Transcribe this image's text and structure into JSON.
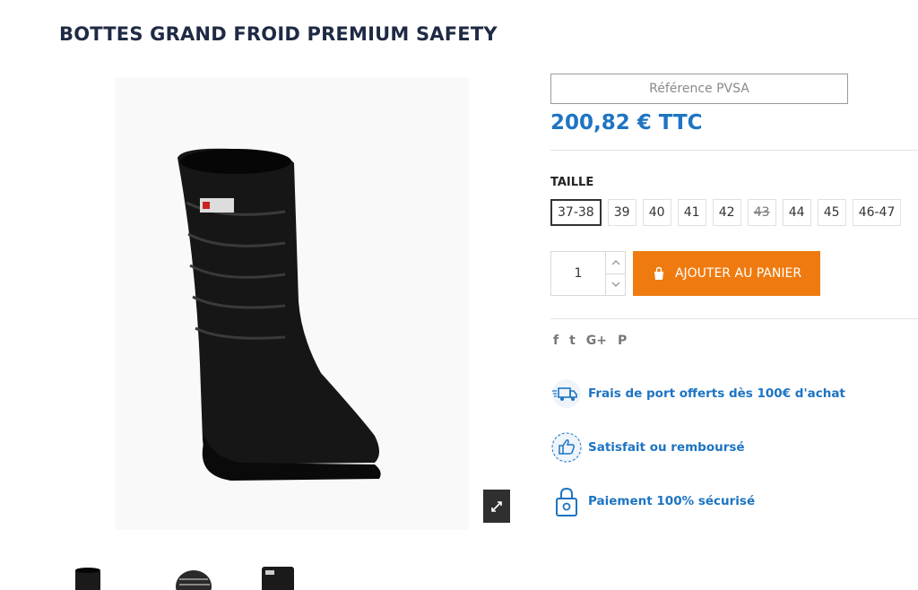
{
  "product": {
    "title": "BOTTES GRAND FROID PREMIUM SAFETY",
    "reference": "Référence PVSA",
    "price": "200,82 € TTC"
  },
  "size_selector": {
    "label": "TAILLE",
    "options": [
      {
        "label": "37-38",
        "selected": true,
        "available": true
      },
      {
        "label": "39",
        "selected": false,
        "available": true
      },
      {
        "label": "40",
        "selected": false,
        "available": true
      },
      {
        "label": "41",
        "selected": false,
        "available": true
      },
      {
        "label": "42",
        "selected": false,
        "available": true
      },
      {
        "label": "43",
        "selected": false,
        "available": false
      },
      {
        "label": "44",
        "selected": false,
        "available": true
      },
      {
        "label": "45",
        "selected": false,
        "available": true
      },
      {
        "label": "46-47",
        "selected": false,
        "available": true
      }
    ]
  },
  "cart": {
    "quantity": "1",
    "add_label": "AJOUTER AU PANIER"
  },
  "social": {
    "icons": [
      "facebook-icon",
      "twitter-icon",
      "google-plus-icon",
      "pinterest-icon"
    ],
    "glyphs": [
      "f",
      "t",
      "G+",
      "P"
    ]
  },
  "features": [
    {
      "icon": "delivery-truck-icon",
      "text": "Frais de port offerts dès 100€ d'achat"
    },
    {
      "icon": "thumbs-up-icon",
      "text": "Satisfait ou remboursé"
    },
    {
      "icon": "padlock-icon",
      "text": "Paiement 100% sécurisé"
    }
  ],
  "colors": {
    "title": "#1f2a44",
    "price": "#1d74c2",
    "cta": "#ef7b10",
    "feature_text": "#1d74c2"
  }
}
